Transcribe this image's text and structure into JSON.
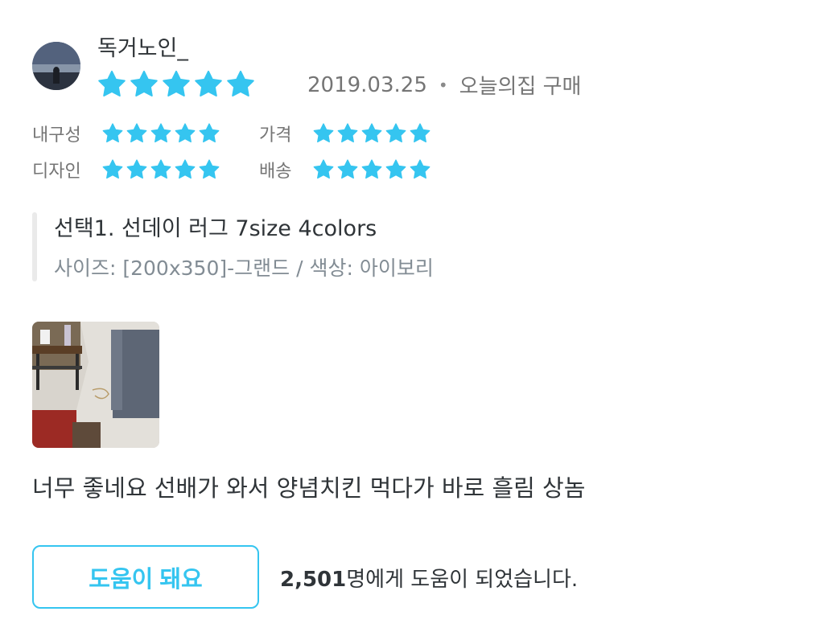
{
  "review": {
    "username": "독거노인_",
    "rating": 5,
    "date": "2019.03.25",
    "source": "오늘의집 구매",
    "star_color": "#35c5f0",
    "sub_ratings": [
      {
        "label": "내구성",
        "rating": 5
      },
      {
        "label": "가격",
        "rating": 5
      },
      {
        "label": "디자인",
        "rating": 5
      },
      {
        "label": "배송",
        "rating": 5
      }
    ],
    "option": {
      "title": "선택1. 선데이 러그 7size 4colors",
      "detail": "사이즈: [200x350]-그랜드 / 색상: 아이보리"
    },
    "text": "너무 좋네요 선배가 와서 양념치킨 먹다가 바로 흘림 상놈"
  },
  "helpful": {
    "button_label": "도움이 돼요",
    "count": "2,501",
    "count_suffix": "명에게 도움이 되었습니다.",
    "accent_color": "#35c5f0"
  }
}
